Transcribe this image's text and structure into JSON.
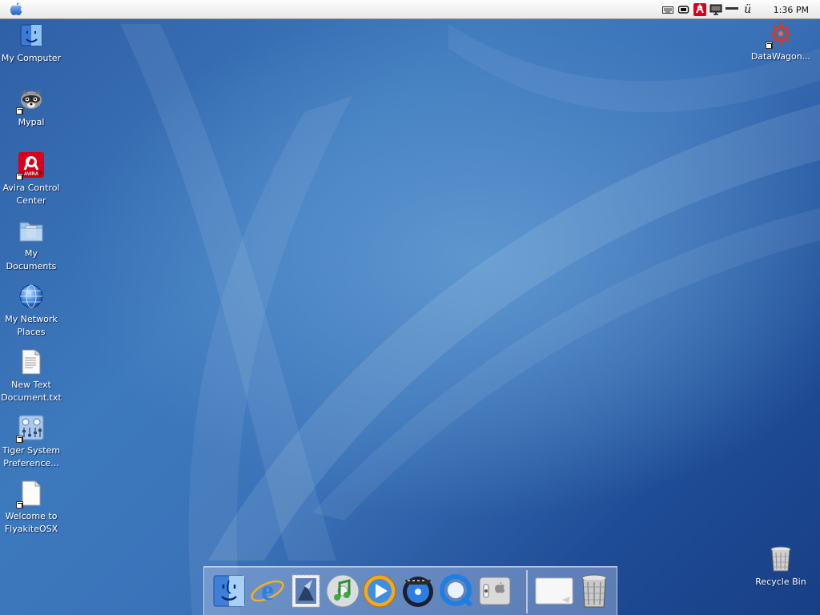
{
  "menubar": {
    "apple_icon": "apple-icon",
    "tray_icons": [
      "keyboard-icon",
      "battery-icon",
      "avira-tray-icon",
      "monitor-icon",
      "volume-icon",
      "language-icon"
    ],
    "language_glyph": "ü",
    "clock": "1:36 PM"
  },
  "desktop": {
    "icons": [
      {
        "label": "My Computer",
        "icon": "my-computer-icon"
      },
      {
        "label": "Mypal",
        "icon": "mypal-raccoon-icon"
      },
      {
        "label": "Avira Control Center",
        "icon": "avira-icon",
        "badge": "AVIRA"
      },
      {
        "label": "My Documents",
        "icon": "documents-folder-icon"
      },
      {
        "label": "My Network Places",
        "icon": "network-globe-icon"
      },
      {
        "label": "New Text Document.txt",
        "icon": "text-document-icon"
      },
      {
        "label": "Tiger System Preference...",
        "icon": "system-preferences-icon"
      },
      {
        "label": "Welcome to FlyakiteOSX",
        "icon": "blank-document-icon"
      },
      {
        "label": "DataWagon...",
        "icon": "datawagon-gear-icon"
      },
      {
        "label": "Recycle Bin",
        "icon": "trash-can-icon"
      }
    ]
  },
  "dock": {
    "items": [
      "finder-icon",
      "internet-explorer-icon",
      "mail-stamp-icon",
      "itunes-icon",
      "media-player-icon",
      "dvd-player-icon",
      "quicktime-icon",
      "system-preferences-switch-icon",
      "blank-window-icon",
      "trash-icon"
    ]
  },
  "colors": {
    "wallpaper": "#3a72b8",
    "avira_red": "#d8001a",
    "menubar": "#f2f2f2"
  }
}
